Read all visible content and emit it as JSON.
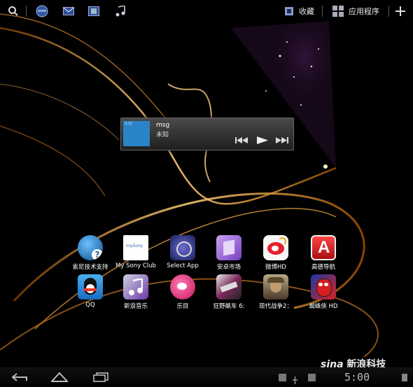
{
  "topbar": {
    "icons": [
      "search-icon",
      "browser-icon",
      "email-icon",
      "video-icon",
      "music-icon"
    ],
    "browser_label": "www",
    "favorites_label": "收藏",
    "apps_label": "应用程序",
    "add_icon": "plus-icon"
  },
  "music_widget": {
    "album_label": "3:12",
    "song": "msg",
    "artist": "未知",
    "controls": [
      "previous-icon",
      "play-icon",
      "next-icon"
    ]
  },
  "apps": [
    {
      "label": "索尼技术支持",
      "icon": "globe-help-icon",
      "color": "#1c6fb0"
    },
    {
      "label": "My Sony Club",
      "icon": "mysony-icon",
      "color": "#ffffff"
    },
    {
      "label": "Select App",
      "icon": "select-app-icon",
      "color": "#3a3f9a"
    },
    {
      "label": "安卓市场",
      "icon": "market-icon",
      "color": "#a06ad0"
    },
    {
      "label": "微博HD",
      "icon": "weibo-icon",
      "color": "#f2b21c"
    },
    {
      "label": "高德导航",
      "icon": "navigation-icon",
      "color": "#d91f26"
    },
    {
      "label": "QQ",
      "icon": "qq-icon",
      "color": "#1a8bd8"
    },
    {
      "label": "新浪音乐",
      "icon": "music-icon",
      "color": "#7a45b8"
    },
    {
      "label": "乐目",
      "icon": "lemu-icon",
      "color": "#e8388a"
    },
    {
      "label": "狂野飙车 6:",
      "icon": "racing-icon",
      "color": "#5a2a4a"
    },
    {
      "label": "现代战争2：",
      "icon": "soldier-icon",
      "color": "#7b6a4a"
    },
    {
      "label": "蜘蛛侠 HD",
      "icon": "spiderman-icon",
      "color": "#b52222"
    }
  ],
  "mysony_text": "mySony",
  "navbar": {
    "back_icon": "back-icon",
    "home_icon": "home-icon",
    "recent_icon": "recent-apps-icon"
  },
  "watermark": {
    "brand": "sina",
    "text": "新浪科技"
  },
  "status": {
    "time": "5:00"
  }
}
